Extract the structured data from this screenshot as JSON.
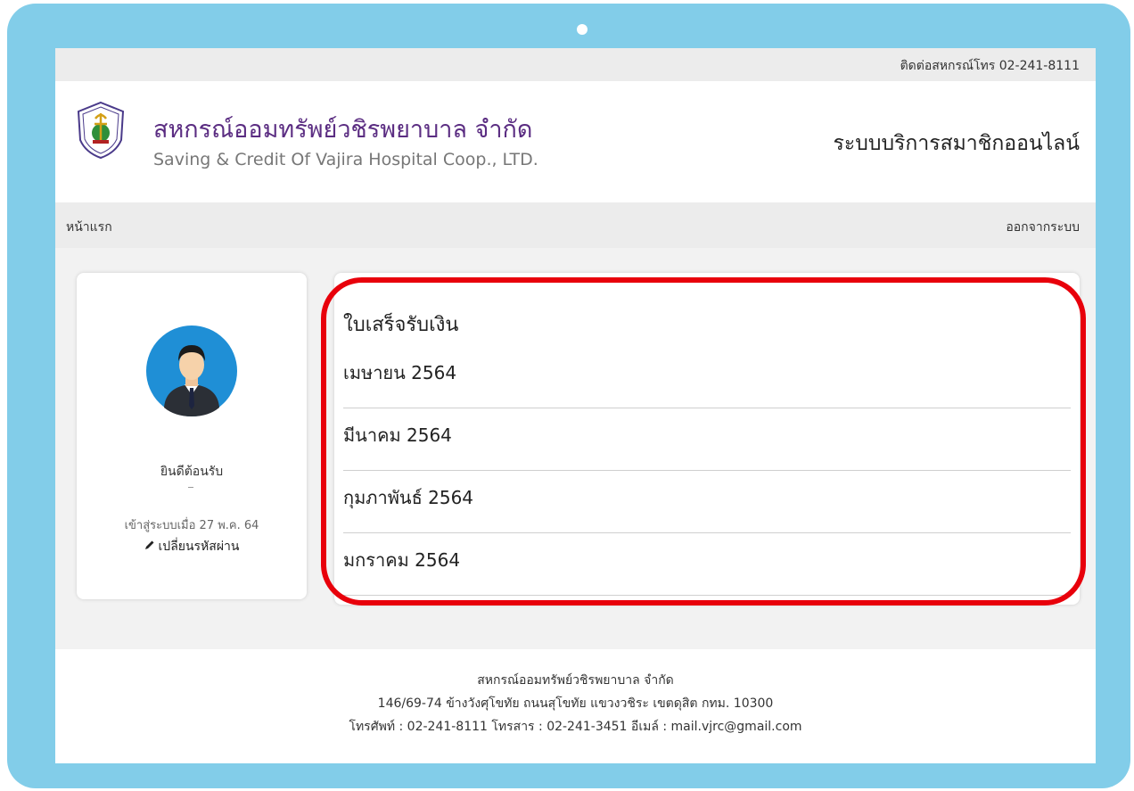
{
  "topbar": {
    "contact": "ติดต่อสหกรณ์โทร 02-241-8111"
  },
  "header": {
    "brand_th": "สหกรณ์ออมทรัพย์วชิรพยาบาล จำกัด",
    "brand_en": "Saving & Credit Of Vajira Hospital Coop., LTD.",
    "system_title": "ระบบบริการสมาชิกออนไลน์"
  },
  "nav": {
    "home": "หน้าแรก",
    "logout": "ออกจากระบบ"
  },
  "profile": {
    "welcome": "ยินดีต้อนรับ",
    "last_login": "เข้าสู่ระบบเมื่อ 27 พ.ค. 64",
    "change_password": "เปลี่ยนรหัสผ่าน"
  },
  "receipts": {
    "title": "ใบเสร็จรับเงิน",
    "items": [
      {
        "label": "เมษายน 2564"
      },
      {
        "label": "มีนาคม 2564"
      },
      {
        "label": "กุมภาพันธ์ 2564"
      },
      {
        "label": "มกราคม 2564"
      }
    ]
  },
  "footer": {
    "line1": "สหกรณ์ออมทรัพย์วชิรพยาบาล จำกัด",
    "line2": "146/69-74 ข้างวังศุโขทัย ถนนสุโขทัย แขวงวชิระ เขตดุสิต กทม. 10300",
    "line3": "โทรศัพท์ : 02-241-8111 โทรสาร : 02-241-3451 อีเมล์ : mail.vjrc@gmail.com"
  },
  "colors": {
    "device_frame": "#82cde9",
    "brand_purple": "#5b2d82",
    "highlight_red": "#e8000b",
    "avatar_blue": "#1f8fd6"
  }
}
